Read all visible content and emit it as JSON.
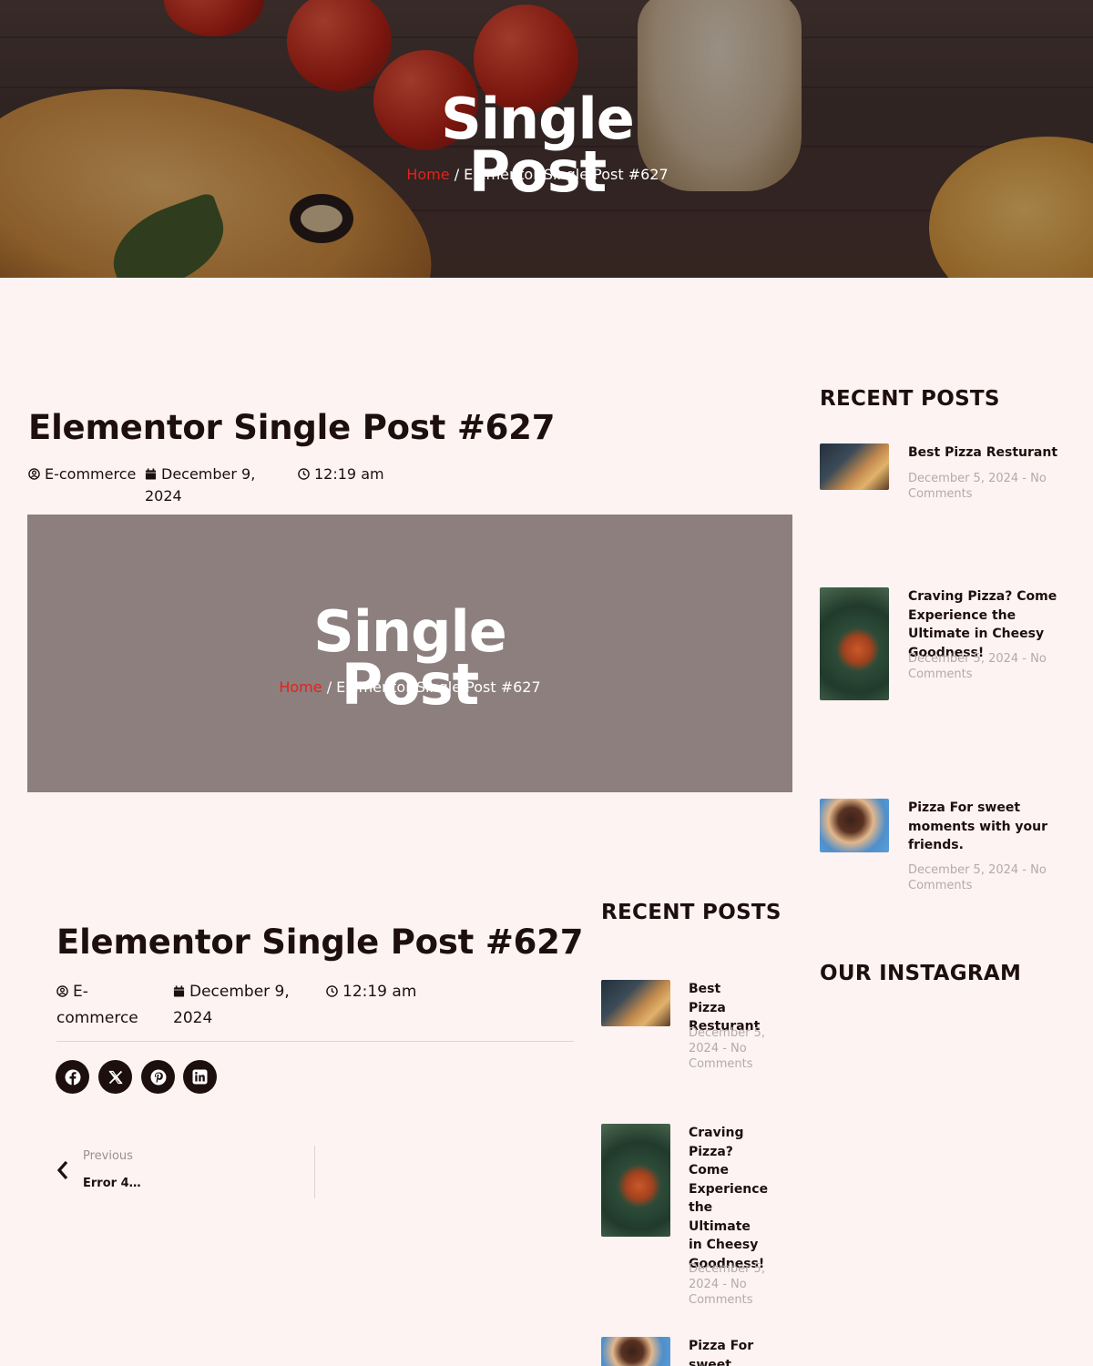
{
  "hero": {
    "title": "Single Post",
    "breadcrumb": {
      "home": "Home",
      "separator": "/",
      "current": "Elementor Single Post #627"
    }
  },
  "post": {
    "title": "Elementor Single Post #627",
    "author": "E-commerce",
    "date": "December 9, 2024",
    "time": "12:19 am"
  },
  "featured_overlay": {
    "title": "Single Post",
    "breadcrumb": {
      "home": "Home",
      "separator": "/",
      "current": "Elementor Single Post #627"
    }
  },
  "sidebar": {
    "recent_title": "RECENT POSTS",
    "instagram_title": "OUR INSTAGRAM",
    "posts": [
      {
        "title": "Best Pizza Resturant",
        "meta": "December 5, 2024 - No Comments",
        "thumb": "pizza-table-photo"
      },
      {
        "title": "Craving Pizza? Come Experience the Ultimate in Cheesy Goodness!",
        "meta": "December 5, 2024 - No Comments",
        "thumb": "pizza-plate-photo"
      },
      {
        "title": "Pizza For sweet moments with your friends.",
        "meta": "December 5, 2024 - No Comments",
        "thumb": "woman-eating-pizza-photo"
      }
    ]
  },
  "inner": {
    "recent_title": "RECENT POSTS",
    "post_title": "Elementor Single Post #627",
    "author": "E-commerce",
    "date": "December 9, 2024",
    "time": "12:19 am",
    "share_icons": [
      "facebook-icon",
      "x-icon",
      "pinterest-icon",
      "linkedin-icon"
    ],
    "prev_label": "Previous",
    "prev_title": "Error 4…",
    "posts": [
      {
        "title": "Best Pizza Resturant",
        "meta": "December 5, 2024 - No Comments"
      },
      {
        "title": "Craving Pizza? Come Experience the Ultimate in Cheesy Goodness!",
        "meta": "December 5, 2024 - No Comments"
      },
      {
        "title": "Pizza For sweet"
      }
    ]
  },
  "colors": {
    "background": "#fdf3f2",
    "text": "#1e0f0f",
    "accent_red": "#e4221b",
    "muted": "#b3aaaa",
    "featured_placeholder": "#8c7f7e"
  }
}
